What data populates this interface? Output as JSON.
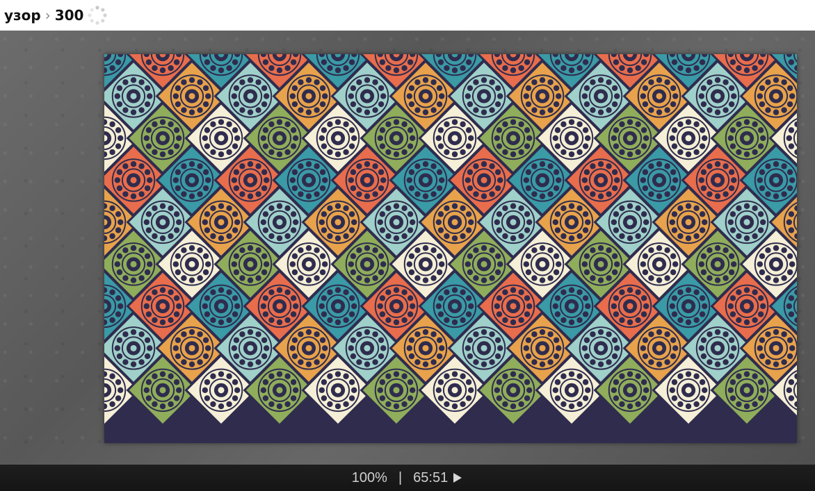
{
  "breadcrumb": {
    "items": [
      "узор",
      "300"
    ]
  },
  "image": {
    "palette": [
      "#2f2c4e",
      "#3a9aa6",
      "#8fad5b",
      "#e7a24b",
      "#e86d4c",
      "#f4efd6",
      "#9fd0c9"
    ]
  },
  "status": {
    "zoom": "100%",
    "divider": "|",
    "timer": "65:51"
  }
}
